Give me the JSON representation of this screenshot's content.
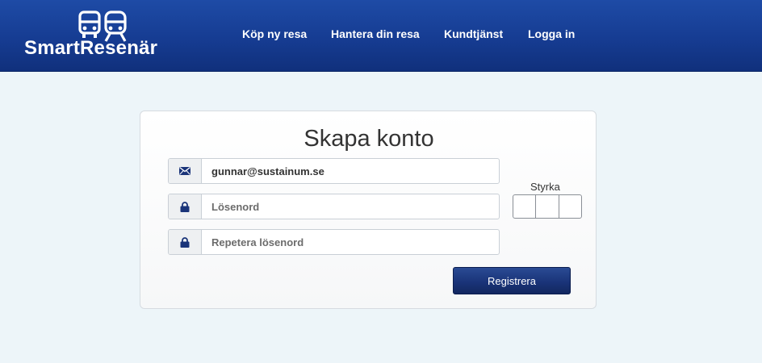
{
  "header": {
    "logo_text": "SmartResenär",
    "logo_icons": [
      "bus-icon",
      "train-icon"
    ],
    "nav": [
      {
        "label": "Köp ny resa"
      },
      {
        "label": "Hantera din resa"
      },
      {
        "label": "Kundtjänst"
      },
      {
        "label": "Logga in"
      }
    ]
  },
  "form": {
    "title": "Skapa konto",
    "email": {
      "value": "gunnar@sustainum.se",
      "placeholder": "",
      "icon": "envelope-icon"
    },
    "password": {
      "value": "",
      "placeholder": "Lösenord",
      "icon": "lock-icon"
    },
    "repeat_password": {
      "value": "",
      "placeholder": "Repetera lösenord",
      "icon": "lock-icon"
    },
    "strength": {
      "label": "Styrka",
      "segments": 3,
      "filled": 0
    },
    "register_label": "Registrera"
  },
  "colors": {
    "header": "#163c92",
    "page_background": "#edf5f9",
    "icon": "#1a3479",
    "button": "#1a3479"
  }
}
